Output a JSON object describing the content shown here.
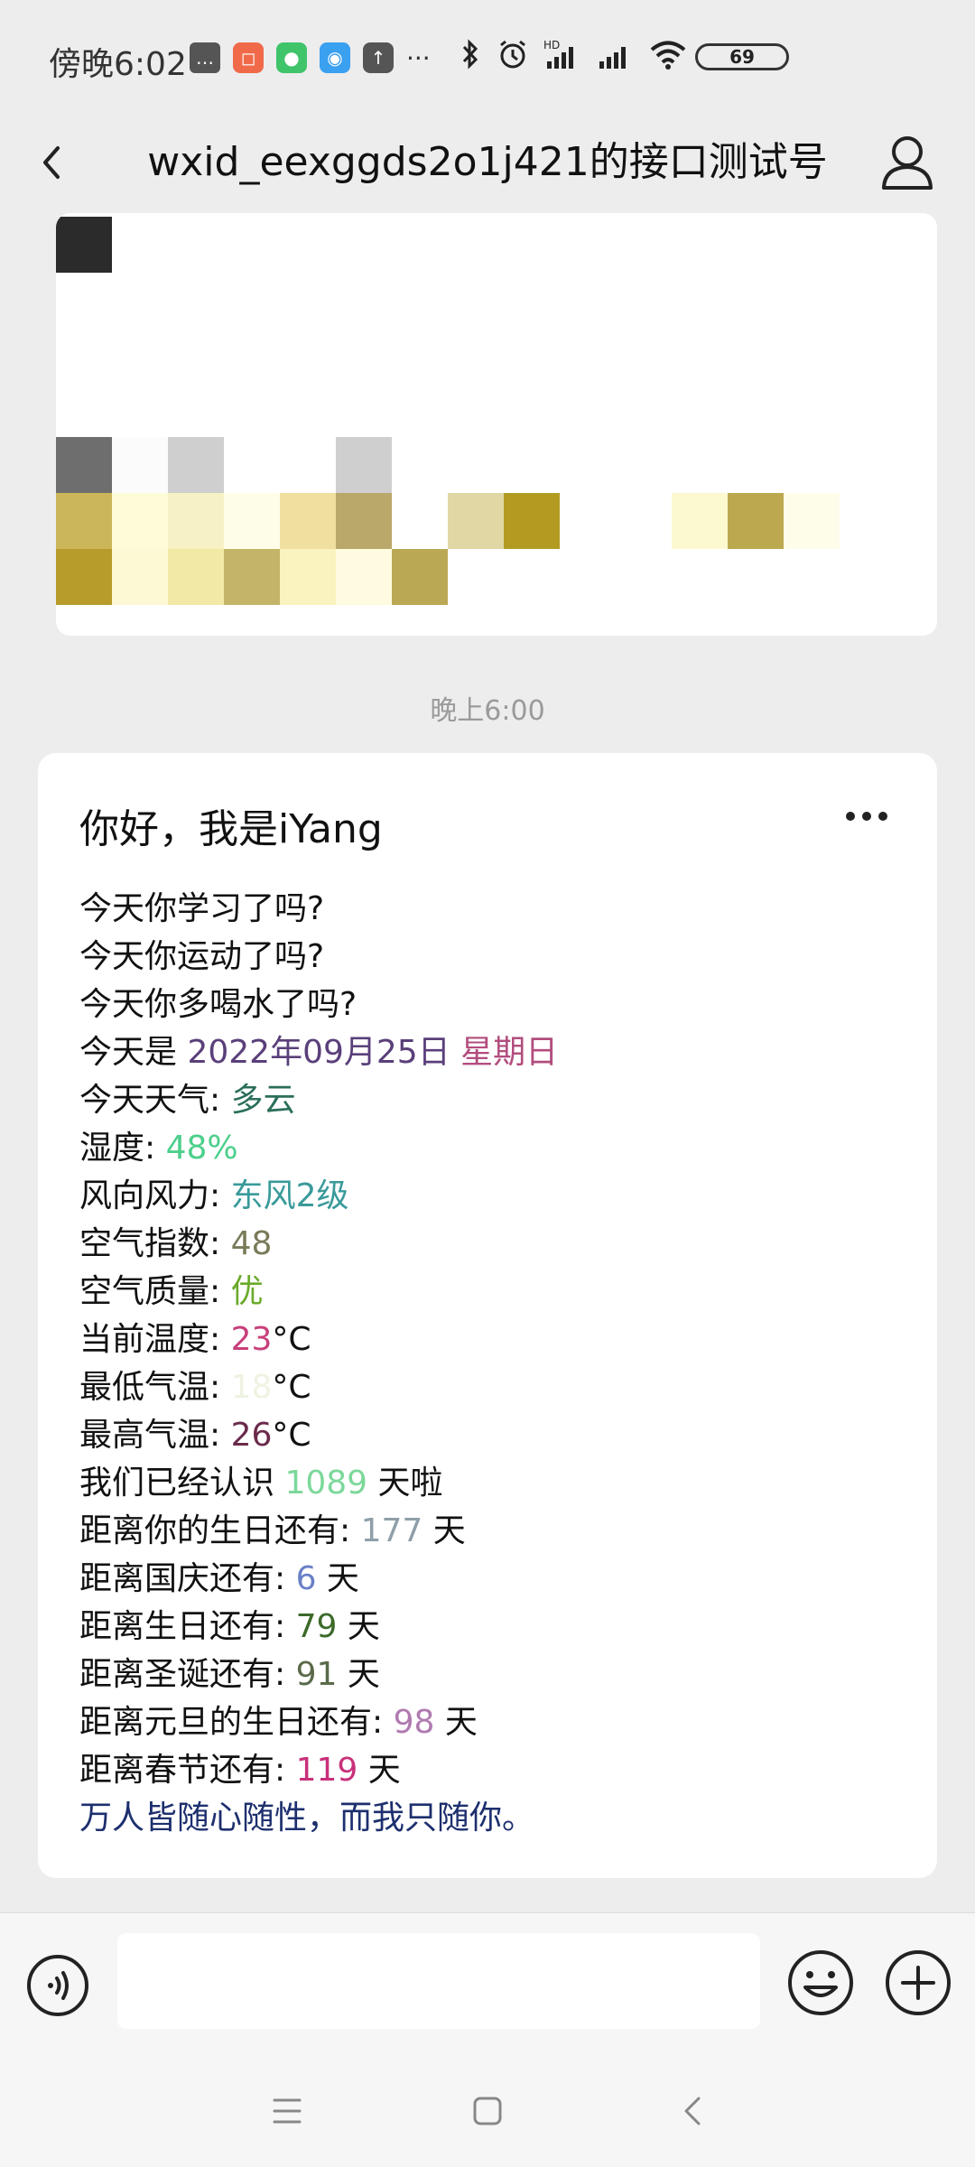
{
  "status_bar": {
    "time": "傍晚6:02",
    "battery": "69",
    "icons": [
      "message-icon",
      "app-icon-red",
      "wechat-icon",
      "qq-icon",
      "upload-icon",
      "more-dots-icon",
      "bluetooth-icon",
      "alarm-icon",
      "signal-hd-icon",
      "signal-icon",
      "wifi-icon",
      "battery-icon"
    ]
  },
  "header": {
    "title": "wxid_eexggds2o1j421的接口测试号"
  },
  "chat": {
    "timestamp": "晚上6:00",
    "message": {
      "title": "你好，我是iYang",
      "lines": [
        {
          "label": "今天你学习了吗?",
          "value": "",
          "value2": "",
          "suffix": ""
        },
        {
          "label": "今天你运动了吗?",
          "value": "",
          "value2": "",
          "suffix": ""
        },
        {
          "label": "今天你多喝水了吗?",
          "value": "",
          "value2": "",
          "suffix": ""
        },
        {
          "label": "今天是 ",
          "value": "2022年09月25日",
          "value2": " 星期日",
          "suffix": ""
        },
        {
          "label": "今天天气: ",
          "value": "多云",
          "value2": "",
          "suffix": ""
        },
        {
          "label": "湿度: ",
          "value": "48%",
          "value2": "",
          "suffix": ""
        },
        {
          "label": "风向风力: ",
          "value": "东风2级",
          "value2": "",
          "suffix": ""
        },
        {
          "label": "空气指数: ",
          "value": "48",
          "value2": "",
          "suffix": ""
        },
        {
          "label": "空气质量: ",
          "value": "优",
          "value2": "",
          "suffix": ""
        },
        {
          "label": "当前温度: ",
          "value": "23",
          "value2": "",
          "suffix": "°C"
        },
        {
          "label": "最低气温: ",
          "value": "18",
          "value2": "",
          "suffix": "°C"
        },
        {
          "label": "最高气温: ",
          "value": "26",
          "value2": "",
          "suffix": "°C"
        },
        {
          "label": "我们已经认识 ",
          "value": "1089",
          "value2": "",
          "suffix": " 天啦"
        },
        {
          "label": "距离你的生日还有: ",
          "value": "177",
          "value2": "",
          "suffix": " 天"
        },
        {
          "label": "距离国庆还有: ",
          "value": "6",
          "value2": "",
          "suffix": " 天"
        },
        {
          "label": "距离生日还有: ",
          "value": "79",
          "value2": "",
          "suffix": " 天"
        },
        {
          "label": "距离圣诞还有: ",
          "value": "91",
          "value2": "",
          "suffix": " 天"
        },
        {
          "label": "距离元旦的生日还有: ",
          "value": "98",
          "value2": "",
          "suffix": " 天"
        },
        {
          "label": "距离春节还有: ",
          "value": "119",
          "value2": "",
          "suffix": " 天"
        }
      ],
      "quote": "万人皆随心随性，而我只随你。"
    }
  },
  "colors": {
    "date": "#5a3f7a",
    "weekday": "#b24d7e",
    "weather": "#2a6e5a",
    "humidity": "#4ccf8b",
    "wind": "#3a9a9a",
    "aqi": "#7a7a5a",
    "quality": "#6aaa2a",
    "temp": "#c8407a",
    "low_temp": "#eef3e2",
    "high_temp": "#6a2a4a",
    "days_known": "#7cd89a",
    "birthday": "#8f9fa8",
    "national": "#6a7fc8",
    "birthday2": "#3c6a2a",
    "christmas": "#5a6a4a",
    "newyear": "#b07ab0",
    "spring": "#c8307a",
    "quote": "#1d2f6e"
  }
}
